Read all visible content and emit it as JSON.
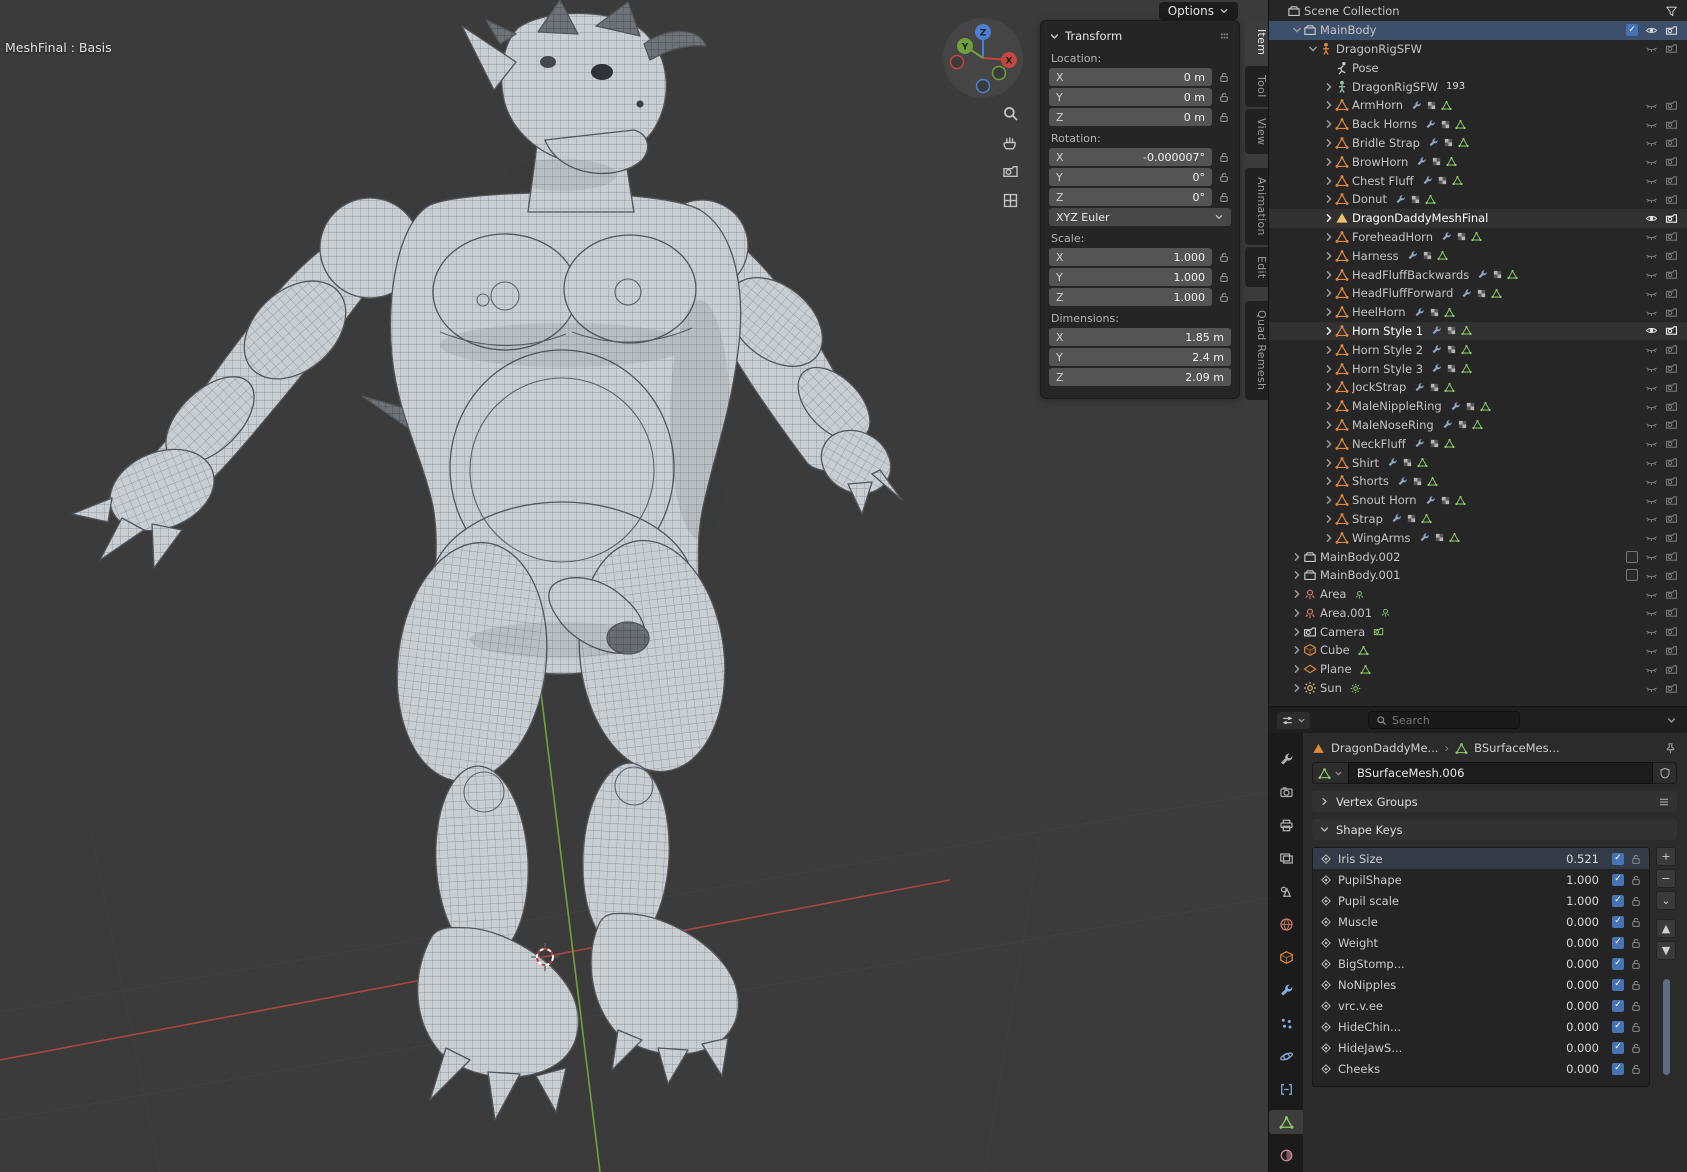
{
  "colors": {
    "accent_blue": "#4772b3",
    "object_orange": "#e0883a",
    "data_green": "#8fce6b",
    "axis_red": "#a84743",
    "axis_green": "#6fa13c"
  },
  "viewport": {
    "corner_label": "MeshFinal : Basis",
    "options_label": "Options",
    "gizmo": {
      "x": "X",
      "y": "Y",
      "z": "Z"
    }
  },
  "transform": {
    "title": "Transform",
    "blocks": [
      {
        "t": "label",
        "text": "Location:"
      },
      {
        "t": "field",
        "k": "X",
        "v": "0 m",
        "lock": true
      },
      {
        "t": "field",
        "k": "Y",
        "v": "0 m",
        "lock": true
      },
      {
        "t": "field",
        "k": "Z",
        "v": "0 m",
        "lock": true
      },
      {
        "t": "label",
        "text": "Rotation:"
      },
      {
        "t": "field",
        "k": "X",
        "v": "-0.000007°",
        "lock": true
      },
      {
        "t": "field",
        "k": "Y",
        "v": "0°",
        "lock": true
      },
      {
        "t": "field",
        "k": "Z",
        "v": "0°",
        "lock": true
      },
      {
        "t": "drop",
        "v": "XYZ Euler"
      },
      {
        "t": "label",
        "text": "Scale:"
      },
      {
        "t": "field",
        "k": "X",
        "v": "1.000",
        "lock": true
      },
      {
        "t": "field",
        "k": "Y",
        "v": "1.000",
        "lock": true
      },
      {
        "t": "field",
        "k": "Z",
        "v": "1.000",
        "lock": true
      },
      {
        "t": "label",
        "text": "Dimensions:"
      },
      {
        "t": "field",
        "k": "X",
        "v": "1.85 m",
        "lock": false
      },
      {
        "t": "field",
        "k": "Y",
        "v": "2.4 m",
        "lock": false
      },
      {
        "t": "field",
        "k": "Z",
        "v": "2.09 m",
        "lock": false
      }
    ],
    "tabs": [
      {
        "label": "Item",
        "active": true
      },
      {
        "label": "Tool"
      },
      {
        "label": "View"
      },
      {
        "label": "Animation",
        "gap": true
      },
      {
        "label": "Edit"
      },
      {
        "label": "Quad Remesh",
        "gap": true
      }
    ]
  },
  "outliner": {
    "rows": [
      {
        "indent": 0,
        "icon": "collection",
        "color": "#c8c8c8",
        "label": "Scene Collection",
        "right": "filter"
      },
      {
        "indent": 1,
        "chev": "d",
        "icon": "collection",
        "color": "#c8c8c8",
        "label": "MainBody",
        "selected": true,
        "right": "col-on"
      },
      {
        "indent": 2,
        "chev": "d",
        "icon": "armature",
        "color": "#e0883a",
        "label": "DragonRigSFW",
        "right": "dim"
      },
      {
        "indent": 3,
        "icon": "pose",
        "color": "#c8c8c8",
        "label": "Pose",
        "right": "none"
      },
      {
        "indent": 3,
        "chev": "r",
        "icon": "armature",
        "color": "#94c79a",
        "label": "DragonRigSFW",
        "extra": "193",
        "right": "none"
      },
      {
        "indent": 3,
        "chev": "r",
        "icon": "mesh",
        "color": "#e0883a",
        "label": "ArmHorn",
        "mid": true,
        "right": "dim"
      },
      {
        "indent": 3,
        "chev": "r",
        "icon": "mesh",
        "color": "#e0883a",
        "label": "Back Horns",
        "mid": true,
        "right": "dim"
      },
      {
        "indent": 3,
        "chev": "r",
        "icon": "mesh",
        "color": "#e0883a",
        "label": "Bridle Strap",
        "mid": true,
        "right": "dim"
      },
      {
        "indent": 3,
        "chev": "r",
        "icon": "mesh",
        "color": "#e0883a",
        "label": "BrowHorn",
        "mid": true,
        "right": "dim"
      },
      {
        "indent": 3,
        "chev": "r",
        "icon": "mesh",
        "color": "#e0883a",
        "label": "Chest Fluff",
        "mid": true,
        "right": "dim"
      },
      {
        "indent": 3,
        "chev": "r",
        "icon": "mesh",
        "color": "#e0883a",
        "label": "Donut",
        "mid": true,
        "right": "dim"
      },
      {
        "indent": 3,
        "chev": "r",
        "icon": "mesh-solid",
        "color": "#edc06a",
        "label": "DragonDaddyMeshFinal",
        "cls": "active",
        "right": "bright"
      },
      {
        "indent": 3,
        "chev": "r",
        "icon": "mesh",
        "color": "#e0883a",
        "label": "ForeheadHorn",
        "mid": true,
        "right": "dim"
      },
      {
        "indent": 3,
        "chev": "r",
        "icon": "mesh",
        "color": "#e0883a",
        "label": "Harness",
        "mid": true,
        "right": "dim"
      },
      {
        "indent": 3,
        "chev": "r",
        "icon": "mesh",
        "color": "#e0883a",
        "label": "HeadFluffBackwards",
        "mid": true,
        "right": "dim"
      },
      {
        "indent": 3,
        "chev": "r",
        "icon": "mesh",
        "color": "#e0883a",
        "label": "HeadFluffForward",
        "mid": true,
        "right": "dim"
      },
      {
        "indent": 3,
        "chev": "r",
        "icon": "mesh",
        "color": "#e0883a",
        "label": "HeelHorn",
        "mid": true,
        "right": "dim"
      },
      {
        "indent": 3,
        "chev": "r",
        "icon": "mesh",
        "color": "#e0883a",
        "label": "Horn Style 1",
        "cls": "active",
        "mid": true,
        "right": "bright"
      },
      {
        "indent": 3,
        "chev": "r",
        "icon": "mesh",
        "color": "#e0883a",
        "label": "Horn Style 2",
        "mid": true,
        "right": "dim"
      },
      {
        "indent": 3,
        "chev": "r",
        "icon": "mesh",
        "color": "#e0883a",
        "label": "Horn Style 3",
        "mid": true,
        "right": "dim"
      },
      {
        "indent": 3,
        "chev": "r",
        "icon": "mesh",
        "color": "#e0883a",
        "label": "JockStrap",
        "mid": true,
        "right": "dim"
      },
      {
        "indent": 3,
        "chev": "r",
        "icon": "mesh",
        "color": "#e0883a",
        "label": "MaleNippleRing",
        "mid": true,
        "right": "dim"
      },
      {
        "indent": 3,
        "chev": "r",
        "icon": "mesh",
        "color": "#e0883a",
        "label": "MaleNoseRing",
        "mid": true,
        "right": "dim"
      },
      {
        "indent": 3,
        "chev": "r",
        "icon": "mesh",
        "color": "#e0883a",
        "label": "NeckFluff",
        "mid": true,
        "right": "dim"
      },
      {
        "indent": 3,
        "chev": "r",
        "icon": "mesh",
        "color": "#e0883a",
        "label": "Shirt",
        "mid": true,
        "right": "dim"
      },
      {
        "indent": 3,
        "chev": "r",
        "icon": "mesh",
        "color": "#e0883a",
        "label": "Shorts",
        "mid": true,
        "right": "dim"
      },
      {
        "indent": 3,
        "chev": "r",
        "icon": "mesh",
        "color": "#e0883a",
        "label": "Snout Horn",
        "mid": true,
        "right": "dim"
      },
      {
        "indent": 3,
        "chev": "r",
        "icon": "mesh",
        "color": "#e0883a",
        "label": "Strap",
        "mid": true,
        "right": "dim"
      },
      {
        "indent": 3,
        "chev": "r",
        "icon": "mesh",
        "color": "#e0883a",
        "label": "WingArms",
        "mid": true,
        "right": "dim"
      },
      {
        "indent": 1,
        "chev": "r",
        "icon": "collection",
        "color": "#c8c8c8",
        "label": "MainBody.002",
        "right": "col-off"
      },
      {
        "indent": 1,
        "chev": "r",
        "icon": "collection",
        "color": "#c8c8c8",
        "label": "MainBody.001",
        "right": "col-off"
      },
      {
        "indent": 1,
        "chev": "r",
        "icon": "light",
        "color": "#dd7a68",
        "label": "Area",
        "mid2": "light",
        "right": "dim"
      },
      {
        "indent": 1,
        "chev": "r",
        "icon": "light",
        "color": "#dd7a68",
        "label": "Area.001",
        "mid2": "light",
        "right": "dim"
      },
      {
        "indent": 1,
        "chev": "r",
        "icon": "cam",
        "color": "#cfcfcf",
        "label": "Camera",
        "mid2": "cam",
        "right": "dim"
      },
      {
        "indent": 1,
        "chev": "r",
        "icon": "cube",
        "color": "#e0883a",
        "label": "Cube",
        "mid2": "mesh",
        "right": "dim"
      },
      {
        "indent": 1,
        "chev": "r",
        "icon": "plane",
        "color": "#e0883a",
        "label": "Plane",
        "mid2": "mesh",
        "right": "dim"
      },
      {
        "indent": 1,
        "chev": "r",
        "icon": "sun",
        "color": "#d9c27a",
        "label": "Sun",
        "mid2": "sun",
        "right": "dim"
      }
    ]
  },
  "properties": {
    "search_placeholder": "Search",
    "breadcrumb": {
      "object": "DragonDaddyMe...",
      "separator": "›",
      "data": "BSurfaceMes..."
    },
    "name_field": "BSurfaceMesh.006",
    "vertex_groups_label": "Vertex Groups",
    "shape_keys_label": "Shape Keys",
    "shape_keys": [
      {
        "name": "Iris Size",
        "value": "0.521"
      },
      {
        "name": "PupilShape",
        "value": "1.000"
      },
      {
        "name": "Pupil scale",
        "value": "1.000"
      },
      {
        "name": "Muscle",
        "value": "0.000"
      },
      {
        "name": "Weight",
        "value": "0.000"
      },
      {
        "name": "BigStomp...",
        "value": "0.000"
      },
      {
        "name": "NoNipples",
        "value": "0.000"
      },
      {
        "name": "vrc.v.ee",
        "value": "0.000"
      },
      {
        "name": "HideChin...",
        "value": "0.000"
      },
      {
        "name": "HideJawS...",
        "value": "0.000"
      },
      {
        "name": "Cheeks",
        "value": "0.000"
      }
    ],
    "list_controls": {
      "add": "+",
      "remove": "−",
      "menu": "⌄",
      "up": "▲",
      "down": "▼"
    },
    "tabs": [
      {
        "id": "tool",
        "icon": "wrench",
        "color": "#b0b0b0"
      },
      {
        "id": "render",
        "icon": "render-cam",
        "color": "#b0b0b0"
      },
      {
        "id": "output",
        "icon": "printer",
        "color": "#b0b0b0"
      },
      {
        "id": "view-layer",
        "icon": "images",
        "color": "#b0b0b0"
      },
      {
        "id": "scene",
        "icon": "scene",
        "color": "#b0b0b0"
      },
      {
        "id": "world",
        "icon": "world",
        "color": "#cf7a6a"
      },
      {
        "id": "object",
        "icon": "cube",
        "color": "#e0883a"
      },
      {
        "id": "modifiers",
        "icon": "wrench",
        "color": "#84aede"
      },
      {
        "id": "particles",
        "icon": "particles",
        "color": "#84aede"
      },
      {
        "id": "physics",
        "icon": "physics",
        "color": "#84aede"
      },
      {
        "id": "constraints",
        "icon": "constraint",
        "color": "#84aede"
      },
      {
        "id": "object-data",
        "icon": "mesh",
        "color": "#8fce6b",
        "active": true
      },
      {
        "id": "material",
        "icon": "material",
        "color": "#cf8a9a"
      }
    ]
  }
}
